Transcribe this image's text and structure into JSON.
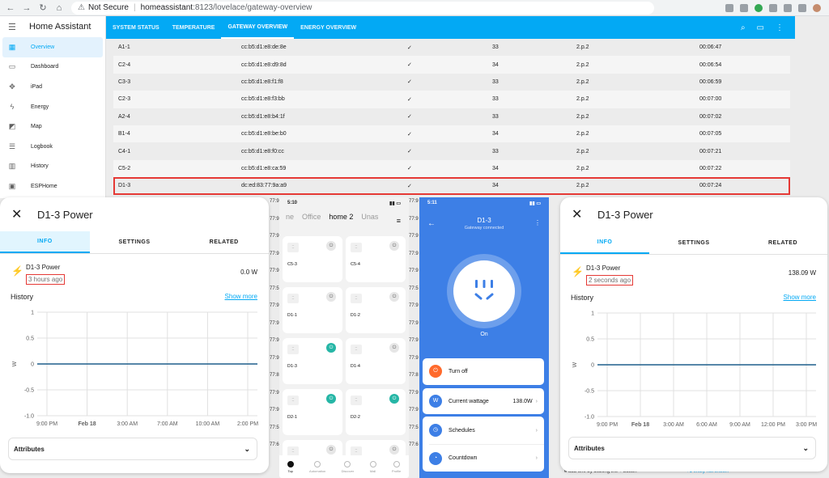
{
  "browser": {
    "security": "Not Secure",
    "host": "homeassistant",
    "path": ":8123/lovelace/gateway-overview"
  },
  "ha": {
    "app_title": "Home Assistant",
    "sidebar": [
      {
        "label": "Overview",
        "icon": "grid-icon",
        "active": true
      },
      {
        "label": "Dashboard",
        "icon": "monitor-icon"
      },
      {
        "label": "iPad",
        "icon": "move-icon"
      },
      {
        "label": "Energy",
        "icon": "bolt-icon"
      },
      {
        "label": "Map",
        "icon": "map-icon"
      },
      {
        "label": "Logbook",
        "icon": "list-icon"
      },
      {
        "label": "History",
        "icon": "bar-chart-icon"
      },
      {
        "label": "ESPHome",
        "icon": "chip-icon"
      }
    ],
    "tabs": [
      "SYSTEM STATUS",
      "TEMPERATURE",
      "GATEWAY OVERVIEW",
      "ENERGY OVERVIEW"
    ],
    "active_tab": 2
  },
  "gateway_table": [
    [
      "A1-1",
      "cc:b5:d1:e8:de:8e",
      "✓",
      "33",
      "2.p.2",
      "00:06:47"
    ],
    [
      "C2-4",
      "cc:b5:d1:e8:d9:8d",
      "✓",
      "34",
      "2.p.2",
      "00:06:54"
    ],
    [
      "C3-3",
      "cc:b5:d1:e8:f1:f8",
      "✓",
      "33",
      "2.p.2",
      "00:06:59"
    ],
    [
      "C2-3",
      "cc:b5:d1:e8:f3:bb",
      "✓",
      "33",
      "2.p.2",
      "00:07:00"
    ],
    [
      "A2-4",
      "cc:b5:d1:e8:b4:1f",
      "✓",
      "33",
      "2.p.2",
      "00:07:02"
    ],
    [
      "B1-4",
      "cc:b5:d1:e8:be:b0",
      "✓",
      "34",
      "2.p.2",
      "00:07:05"
    ],
    [
      "C4-1",
      "cc:b5:d1:e8:f0:cc",
      "✓",
      "33",
      "2.p.2",
      "00:07:21"
    ],
    [
      "C5-2",
      "cc:b5:d1:e8:ca:59",
      "✓",
      "34",
      "2.p.2",
      "00:07:22"
    ],
    [
      "D1-3",
      "dc:ed:83:77:9a:a9",
      "✓",
      "34",
      "2.p.2",
      "00:07:24"
    ]
  ],
  "background_fragments": [
    "77:9",
    "77:9",
    "77:9",
    "77:9",
    "77:9",
    "77:5",
    "77:9",
    "77:9",
    "77:9",
    "77:9",
    "77:8",
    "77:9",
    "77:9",
    "77:5",
    "77:6"
  ],
  "background_text": {
    "footer_left": "e add one by clicking the + button",
    "footer_right": "+1 entity not shown"
  },
  "dialog_left": {
    "title": "D1-3 Power",
    "tabs": [
      "INFO",
      "SETTINGS",
      "RELATED"
    ],
    "entity": "D1-3 Power",
    "ago": "3 hours ago",
    "value": "0.0 W",
    "history": "History",
    "show_more": "Show more",
    "attributes": "Attributes"
  },
  "dialog_right": {
    "title": "D1-3 Power",
    "tabs": [
      "INFO",
      "SETTINGS",
      "RELATED"
    ],
    "entity": "D1-3 Power",
    "ago": "2 seconds ago",
    "value": "138.09 W",
    "history": "History",
    "show_more": "Show more",
    "attributes": "Attributes"
  },
  "chart_data": [
    {
      "type": "line",
      "title": "",
      "ylabel": "W",
      "ylim": [
        -1.0,
        1.0
      ],
      "yticks": [
        "1",
        "0.5",
        "0",
        "-0.5",
        "-1.0"
      ],
      "xticks": [
        "9:00 PM",
        "Feb 18",
        "3:00 AM",
        "7:00 AM",
        "10:00 AM",
        "2:00 PM"
      ],
      "series": [
        {
          "values": [
            0,
            0
          ]
        }
      ],
      "grid": true
    },
    {
      "type": "line",
      "title": "",
      "ylabel": "W",
      "ylim": [
        -1.0,
        1.0
      ],
      "yticks": [
        "1",
        "0.5",
        "0",
        "-0.5",
        "-1.0"
      ],
      "xticks": [
        "9:00 PM",
        "Feb 18",
        "3:00 AM",
        "6:00 AM",
        "9:00 AM",
        "12:00 PM",
        "3:00 PM"
      ],
      "series": [
        {
          "values": [
            0,
            0
          ]
        }
      ],
      "grid": true
    }
  ],
  "phone_home": {
    "time": "5:10",
    "rooms": [
      "ne",
      "Office",
      "home 2",
      "Unas"
    ],
    "current_room": "home 2",
    "devices": [
      {
        "name": "C5-3",
        "on": false
      },
      {
        "name": "C5-4",
        "on": false
      },
      {
        "name": "D1-1",
        "on": false
      },
      {
        "name": "D1-2",
        "on": false
      },
      {
        "name": "D1-3",
        "on": true
      },
      {
        "name": "D1-4",
        "on": false
      },
      {
        "name": "D2-1",
        "on": true
      },
      {
        "name": "D2-2",
        "on": true
      },
      {
        "name": "D2-3",
        "on": false
      },
      {
        "name": "D2-4",
        "on": false
      }
    ],
    "tabbar": [
      "Top",
      "Automation",
      "Discover",
      "Mall",
      "Profile"
    ]
  },
  "phone_device": {
    "time": "5:11",
    "title": "D1-3",
    "subtitle": "Gateway connected",
    "state": "On",
    "turn_off": "Turn off",
    "wattage_label": "Current wattage",
    "wattage_value": "138.0W",
    "schedules": "Schedules",
    "countdown": "Countdown"
  },
  "colors": {
    "ha_primary": "#03a9f4",
    "highlight": "#e53935",
    "device_blue": "#3d7fe6",
    "on_green": "#26b6a6"
  }
}
